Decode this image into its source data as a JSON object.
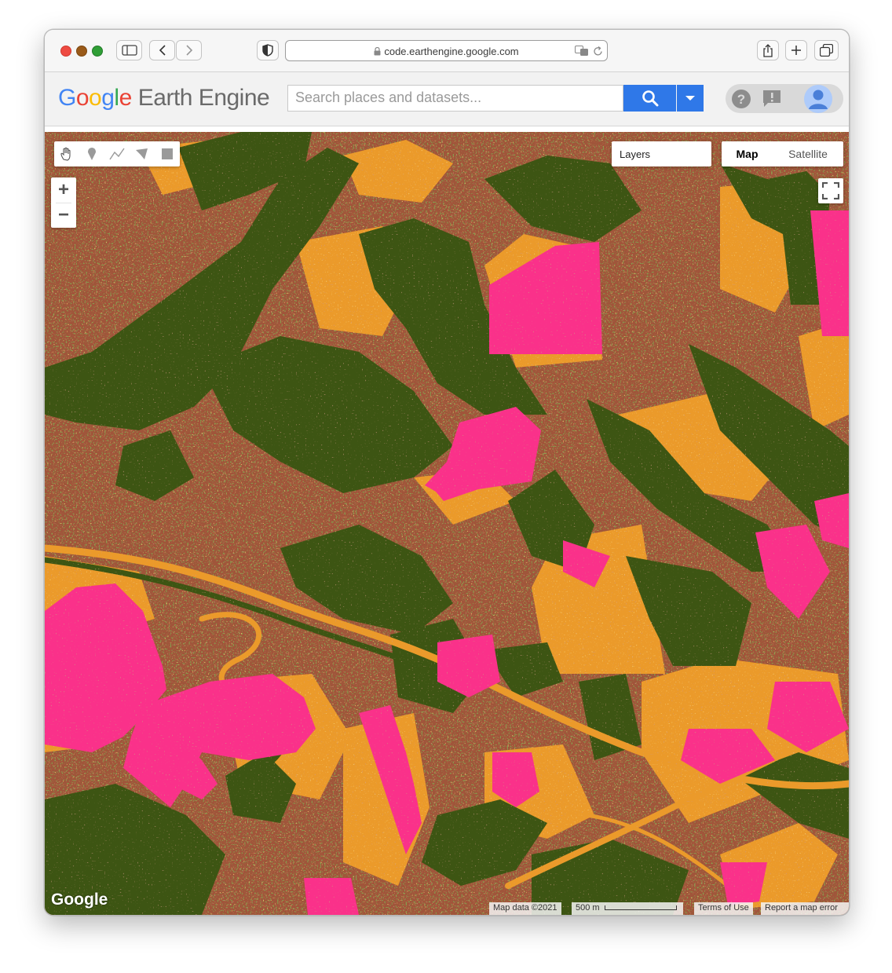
{
  "browser": {
    "url": "code.earthengine.google.com",
    "colors": {
      "close": "#ee4b42",
      "minimize": "#9a5a19",
      "zoom": "#2f9e36"
    }
  },
  "header": {
    "logo_google": [
      "G",
      "o",
      "o",
      "g",
      "l",
      "e"
    ],
    "logo_google_colors": [
      "#4285f4",
      "#ea4335",
      "#fbbc05",
      "#4285f4",
      "#34a853",
      "#ea4335"
    ],
    "logo_product": "Earth Engine",
    "search_placeholder": "Search places and datasets...",
    "accent": "#2f78e8"
  },
  "map": {
    "layers_label": "Layers",
    "map_type_map": "Map",
    "map_type_satellite": "Satellite",
    "zoom_in": "+",
    "zoom_out": "−",
    "watermark": "Google",
    "attribution_data": "Map data ©2021",
    "scale_label": "500 m",
    "terms": "Terms of Use",
    "report": "Report a map error",
    "palette": {
      "forest": "#3d5513",
      "bare": "#a0553a",
      "grass": "#eb9a2a",
      "cleared": "#fa318a"
    },
    "tools": [
      "hand-icon",
      "marker-icon",
      "line-icon",
      "polygon-icon",
      "rectangle-icon"
    ]
  }
}
